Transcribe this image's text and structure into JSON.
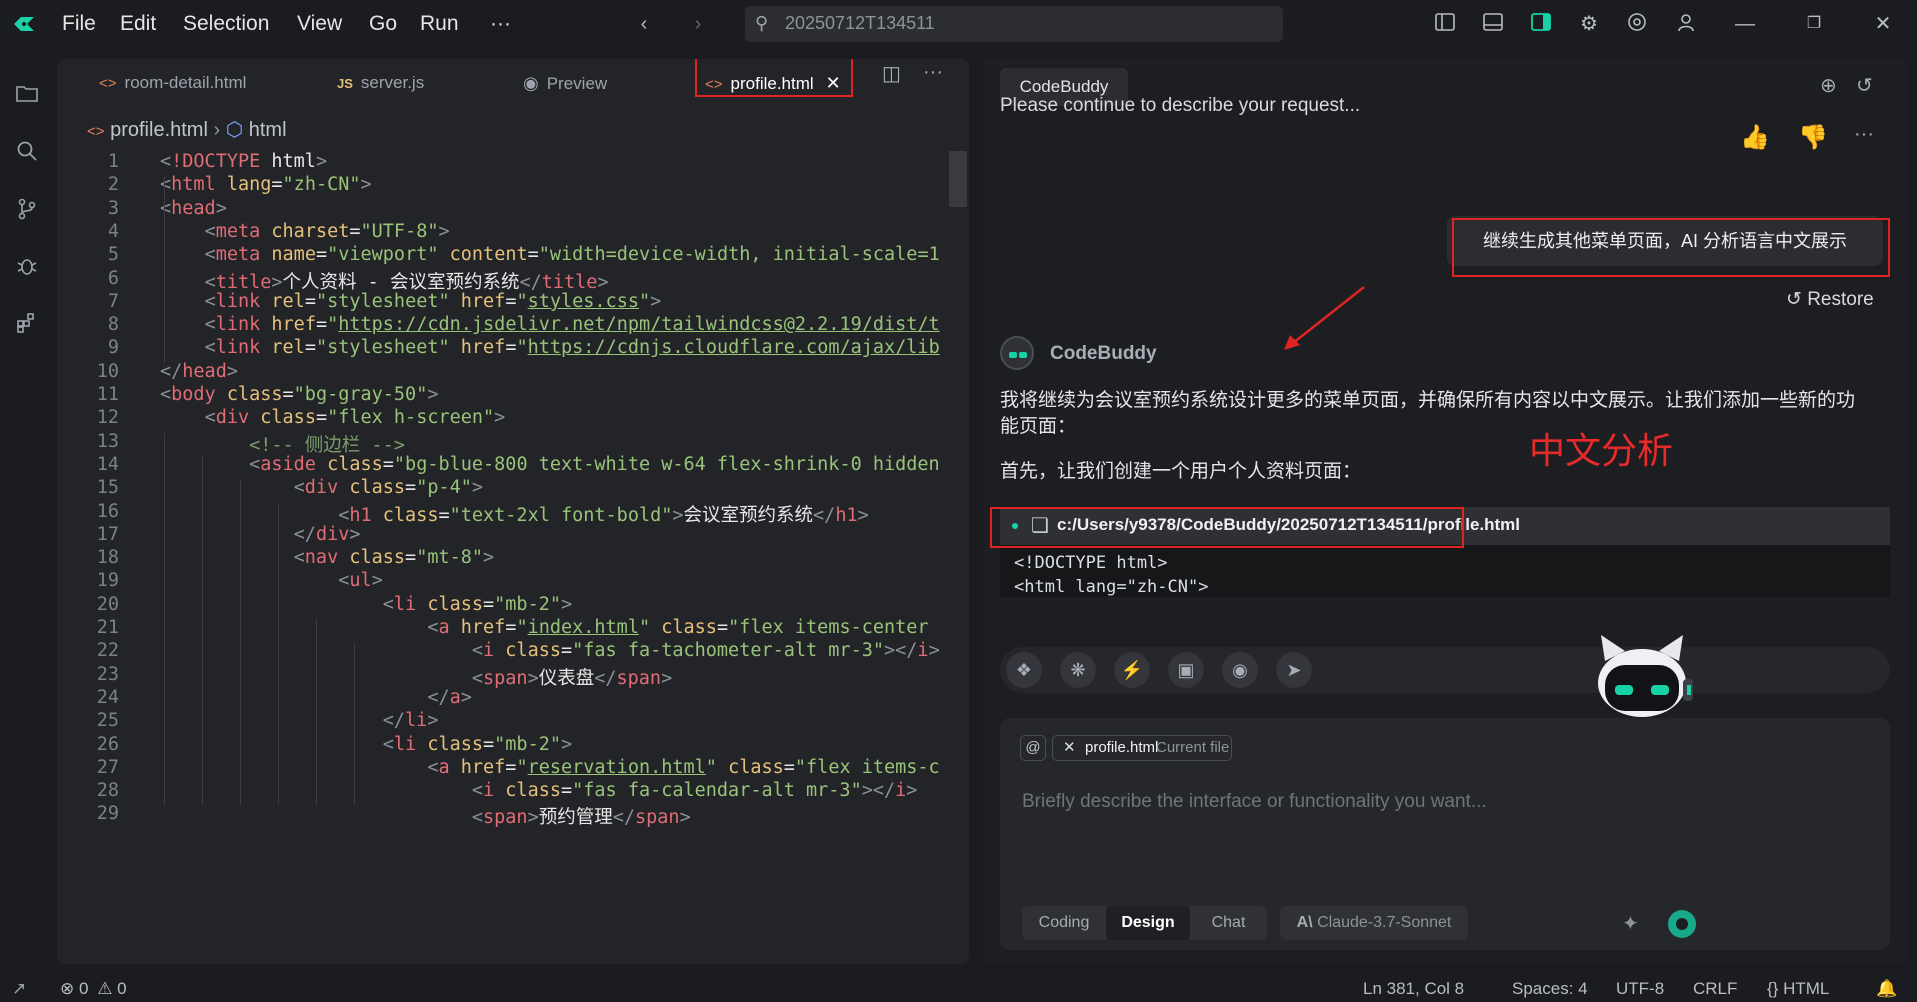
{
  "menu": [
    "File",
    "Edit",
    "Selection",
    "View",
    "Go",
    "Run",
    "···"
  ],
  "search": {
    "value": "20250712T134511"
  },
  "editor": {
    "tabs": [
      {
        "label": "room-detail.html",
        "icon": "html-icon"
      },
      {
        "label": "server.js",
        "icon": "js-icon"
      },
      {
        "label": "Preview",
        "icon": "eye-icon"
      },
      {
        "label": "profile.html",
        "icon": "html-icon",
        "active": true
      }
    ],
    "breadcrumb": {
      "file": "profile.html",
      "node": "html"
    },
    "line_numbers": [
      "1",
      "2",
      "3",
      "4",
      "5",
      "6",
      "7",
      "8",
      "9",
      "10",
      "11",
      "12",
      "13",
      "14",
      "15",
      "16",
      "17",
      "18",
      "19",
      "20",
      "21",
      "22",
      "23",
      "24",
      "25",
      "26",
      "27",
      "28",
      "29"
    ],
    "code": [
      [
        [
          "p",
          "<"
        ],
        [
          "t",
          "!DOCTYPE"
        ],
        [
          "w",
          " html"
        ],
        [
          "p",
          ">"
        ]
      ],
      [
        [
          "p",
          "<"
        ],
        [
          "t",
          "html"
        ],
        [
          "a",
          " lang"
        ],
        [
          "w",
          "="
        ],
        [
          "s",
          "\"zh-CN\""
        ],
        [
          "p",
          ">"
        ]
      ],
      [
        [
          "p",
          "<"
        ],
        [
          "t",
          "head"
        ],
        [
          "p",
          ">"
        ]
      ],
      [
        [
          "w",
          "    "
        ],
        [
          "p",
          "<"
        ],
        [
          "t",
          "meta"
        ],
        [
          "a",
          " charset"
        ],
        [
          "w",
          "="
        ],
        [
          "s",
          "\"UTF-8\""
        ],
        [
          "p",
          ">"
        ]
      ],
      [
        [
          "w",
          "    "
        ],
        [
          "p",
          "<"
        ],
        [
          "t",
          "meta"
        ],
        [
          "a",
          " name"
        ],
        [
          "w",
          "="
        ],
        [
          "s",
          "\"viewport\""
        ],
        [
          "a",
          " content"
        ],
        [
          "w",
          "="
        ],
        [
          "s",
          "\"width=device-width, initial-scale=1"
        ]
      ],
      [
        [
          "w",
          "    "
        ],
        [
          "p",
          "<"
        ],
        [
          "t",
          "title"
        ],
        [
          "p",
          ">"
        ],
        [
          "w",
          "个人资料 - 会议室预约系统"
        ],
        [
          "p",
          "</"
        ],
        [
          "t",
          "title"
        ],
        [
          "p",
          ">"
        ]
      ],
      [
        [
          "w",
          "    "
        ],
        [
          "p",
          "<"
        ],
        [
          "t",
          "link"
        ],
        [
          "a",
          " rel"
        ],
        [
          "w",
          "="
        ],
        [
          "s",
          "\"stylesheet\""
        ],
        [
          "a",
          " href"
        ],
        [
          "w",
          "="
        ],
        [
          "s",
          "\""
        ],
        [
          "u",
          "styles.css"
        ],
        [
          "s",
          "\""
        ],
        [
          "p",
          ">"
        ]
      ],
      [
        [
          "w",
          "    "
        ],
        [
          "p",
          "<"
        ],
        [
          "t",
          "link"
        ],
        [
          "a",
          " href"
        ],
        [
          "w",
          "="
        ],
        [
          "s",
          "\""
        ],
        [
          "u",
          "https://cdn.jsdelivr.net/npm/tailwindcss@2.2.19/dist/t"
        ]
      ],
      [
        [
          "w",
          "    "
        ],
        [
          "p",
          "<"
        ],
        [
          "t",
          "link"
        ],
        [
          "a",
          " rel"
        ],
        [
          "w",
          "="
        ],
        [
          "s",
          "\"stylesheet\""
        ],
        [
          "a",
          " href"
        ],
        [
          "w",
          "="
        ],
        [
          "s",
          "\""
        ],
        [
          "u",
          "https://cdnjs.cloudflare.com/ajax/lib"
        ]
      ],
      [
        [
          "p",
          "</"
        ],
        [
          "t",
          "head"
        ],
        [
          "p",
          ">"
        ]
      ],
      [
        [
          "p",
          "<"
        ],
        [
          "t",
          "body"
        ],
        [
          "a",
          " class"
        ],
        [
          "w",
          "="
        ],
        [
          "s",
          "\"bg-gray-50\""
        ],
        [
          "p",
          ">"
        ]
      ],
      [
        [
          "w",
          "    "
        ],
        [
          "p",
          "<"
        ],
        [
          "t",
          "div"
        ],
        [
          "a",
          " class"
        ],
        [
          "w",
          "="
        ],
        [
          "s",
          "\"flex h-screen\""
        ],
        [
          "p",
          ">"
        ]
      ],
      [
        [
          "w",
          "        "
        ],
        [
          "c",
          "<!-- 侧边栏 -->"
        ]
      ],
      [
        [
          "w",
          "        "
        ],
        [
          "p",
          "<"
        ],
        [
          "t",
          "aside"
        ],
        [
          "a",
          " class"
        ],
        [
          "w",
          "="
        ],
        [
          "s",
          "\"bg-blue-800 text-white w-64 flex-shrink-0 hidden"
        ]
      ],
      [
        [
          "w",
          "            "
        ],
        [
          "p",
          "<"
        ],
        [
          "t",
          "div"
        ],
        [
          "a",
          " class"
        ],
        [
          "w",
          "="
        ],
        [
          "s",
          "\"p-4\""
        ],
        [
          "p",
          ">"
        ]
      ],
      [
        [
          "w",
          "                "
        ],
        [
          "p",
          "<"
        ],
        [
          "t",
          "h1"
        ],
        [
          "a",
          " class"
        ],
        [
          "w",
          "="
        ],
        [
          "s",
          "\"text-2xl font-bold\""
        ],
        [
          "p",
          ">"
        ],
        [
          "w",
          "会议室预约系统"
        ],
        [
          "p",
          "</"
        ],
        [
          "t",
          "h1"
        ],
        [
          "p",
          ">"
        ]
      ],
      [
        [
          "w",
          "            "
        ],
        [
          "p",
          "</"
        ],
        [
          "t",
          "div"
        ],
        [
          "p",
          ">"
        ]
      ],
      [
        [
          "w",
          "            "
        ],
        [
          "p",
          "<"
        ],
        [
          "t",
          "nav"
        ],
        [
          "a",
          " class"
        ],
        [
          "w",
          "="
        ],
        [
          "s",
          "\"mt-8\""
        ],
        [
          "p",
          ">"
        ]
      ],
      [
        [
          "w",
          "                "
        ],
        [
          "p",
          "<"
        ],
        [
          "t",
          "ul"
        ],
        [
          "p",
          ">"
        ]
      ],
      [
        [
          "w",
          "                    "
        ],
        [
          "p",
          "<"
        ],
        [
          "t",
          "li"
        ],
        [
          "a",
          " class"
        ],
        [
          "w",
          "="
        ],
        [
          "s",
          "\"mb-2\""
        ],
        [
          "p",
          ">"
        ]
      ],
      [
        [
          "w",
          "                        "
        ],
        [
          "p",
          "<"
        ],
        [
          "t",
          "a"
        ],
        [
          "a",
          " href"
        ],
        [
          "w",
          "="
        ],
        [
          "s",
          "\""
        ],
        [
          "u",
          "index.html"
        ],
        [
          "s",
          "\""
        ],
        [
          "a",
          " class"
        ],
        [
          "w",
          "="
        ],
        [
          "s",
          "\"flex items-center"
        ]
      ],
      [
        [
          "w",
          "                            "
        ],
        [
          "p",
          "<"
        ],
        [
          "t",
          "i"
        ],
        [
          "a",
          " class"
        ],
        [
          "w",
          "="
        ],
        [
          "s",
          "\"fas fa-tachometer-alt mr-3\""
        ],
        [
          "p",
          "></"
        ],
        [
          "t",
          "i"
        ],
        [
          "p",
          ">"
        ]
      ],
      [
        [
          "w",
          "                            "
        ],
        [
          "p",
          "<"
        ],
        [
          "t",
          "span"
        ],
        [
          "p",
          ">"
        ],
        [
          "w",
          "仪表盘"
        ],
        [
          "p",
          "</"
        ],
        [
          "t",
          "span"
        ],
        [
          "p",
          ">"
        ]
      ],
      [
        [
          "w",
          "                        "
        ],
        [
          "p",
          "</"
        ],
        [
          "t",
          "a"
        ],
        [
          "p",
          ">"
        ]
      ],
      [
        [
          "w",
          "                    "
        ],
        [
          "p",
          "</"
        ],
        [
          "t",
          "li"
        ],
        [
          "p",
          ">"
        ]
      ],
      [
        [
          "w",
          "                    "
        ],
        [
          "p",
          "<"
        ],
        [
          "t",
          "li"
        ],
        [
          "a",
          " class"
        ],
        [
          "w",
          "="
        ],
        [
          "s",
          "\"mb-2\""
        ],
        [
          "p",
          ">"
        ]
      ],
      [
        [
          "w",
          "                        "
        ],
        [
          "p",
          "<"
        ],
        [
          "t",
          "a"
        ],
        [
          "a",
          " href"
        ],
        [
          "w",
          "="
        ],
        [
          "s",
          "\""
        ],
        [
          "u",
          "reservation.html"
        ],
        [
          "s",
          "\""
        ],
        [
          "a",
          " class"
        ],
        [
          "w",
          "="
        ],
        [
          "s",
          "\"flex items-c"
        ]
      ],
      [
        [
          "w",
          "                            "
        ],
        [
          "p",
          "<"
        ],
        [
          "t",
          "i"
        ],
        [
          "a",
          " class"
        ],
        [
          "w",
          "="
        ],
        [
          "s",
          "\"fas fa-calendar-alt mr-3\""
        ],
        [
          "p",
          "></"
        ],
        [
          "t",
          "i"
        ],
        [
          "p",
          ">"
        ]
      ],
      [
        [
          "w",
          "                            "
        ],
        [
          "p",
          "<"
        ],
        [
          "t",
          "span"
        ],
        [
          "p",
          ">"
        ],
        [
          "w",
          "预约管理"
        ],
        [
          "p",
          "</"
        ],
        [
          "t",
          "span"
        ],
        [
          "p",
          ">"
        ]
      ]
    ]
  },
  "chat": {
    "tab_label": "CodeBuddy",
    "prompt_text": "Please continue to describe your request...",
    "user_message": "继续生成其他菜单页面，AI 分析语言中文展示",
    "restore_label": "Restore",
    "assistant_name": "CodeBuddy",
    "assistant_line1": "我将继续为会议室预约系统设计更多的菜单页面，并确保所有内容以中文展示。让我们添加一些新的功",
    "assistant_line2": "能页面：",
    "assistant_line3": "首先，让我们创建一个用户个人资料页面：",
    "annotation": "中文分析",
    "file_path": "c:/Users/y9378/CodeBuddy/20250712T134511/profile.html",
    "file_code": [
      "<!DOCTYPE html>",
      "<html lang=\"zh-CN\">"
    ],
    "context_chip": {
      "file": "profile.html",
      "tag": "Current file"
    },
    "input_placeholder": "Briefly describe the interface or functionality you want...",
    "modes": [
      "Coding",
      "Design",
      "Chat"
    ],
    "active_mode": "Design",
    "model": "Claude-3.7-Sonnet"
  },
  "status": {
    "errors": "0",
    "warnings": "0",
    "position": "Ln 381, Col 8",
    "spaces": "Spaces: 4",
    "encoding": "UTF-8",
    "eol": "CRLF",
    "language": "HTML"
  },
  "colors": {
    "accent": "#17d2a6",
    "annotation_red": "#e02424",
    "background": "#1b1c1f"
  }
}
